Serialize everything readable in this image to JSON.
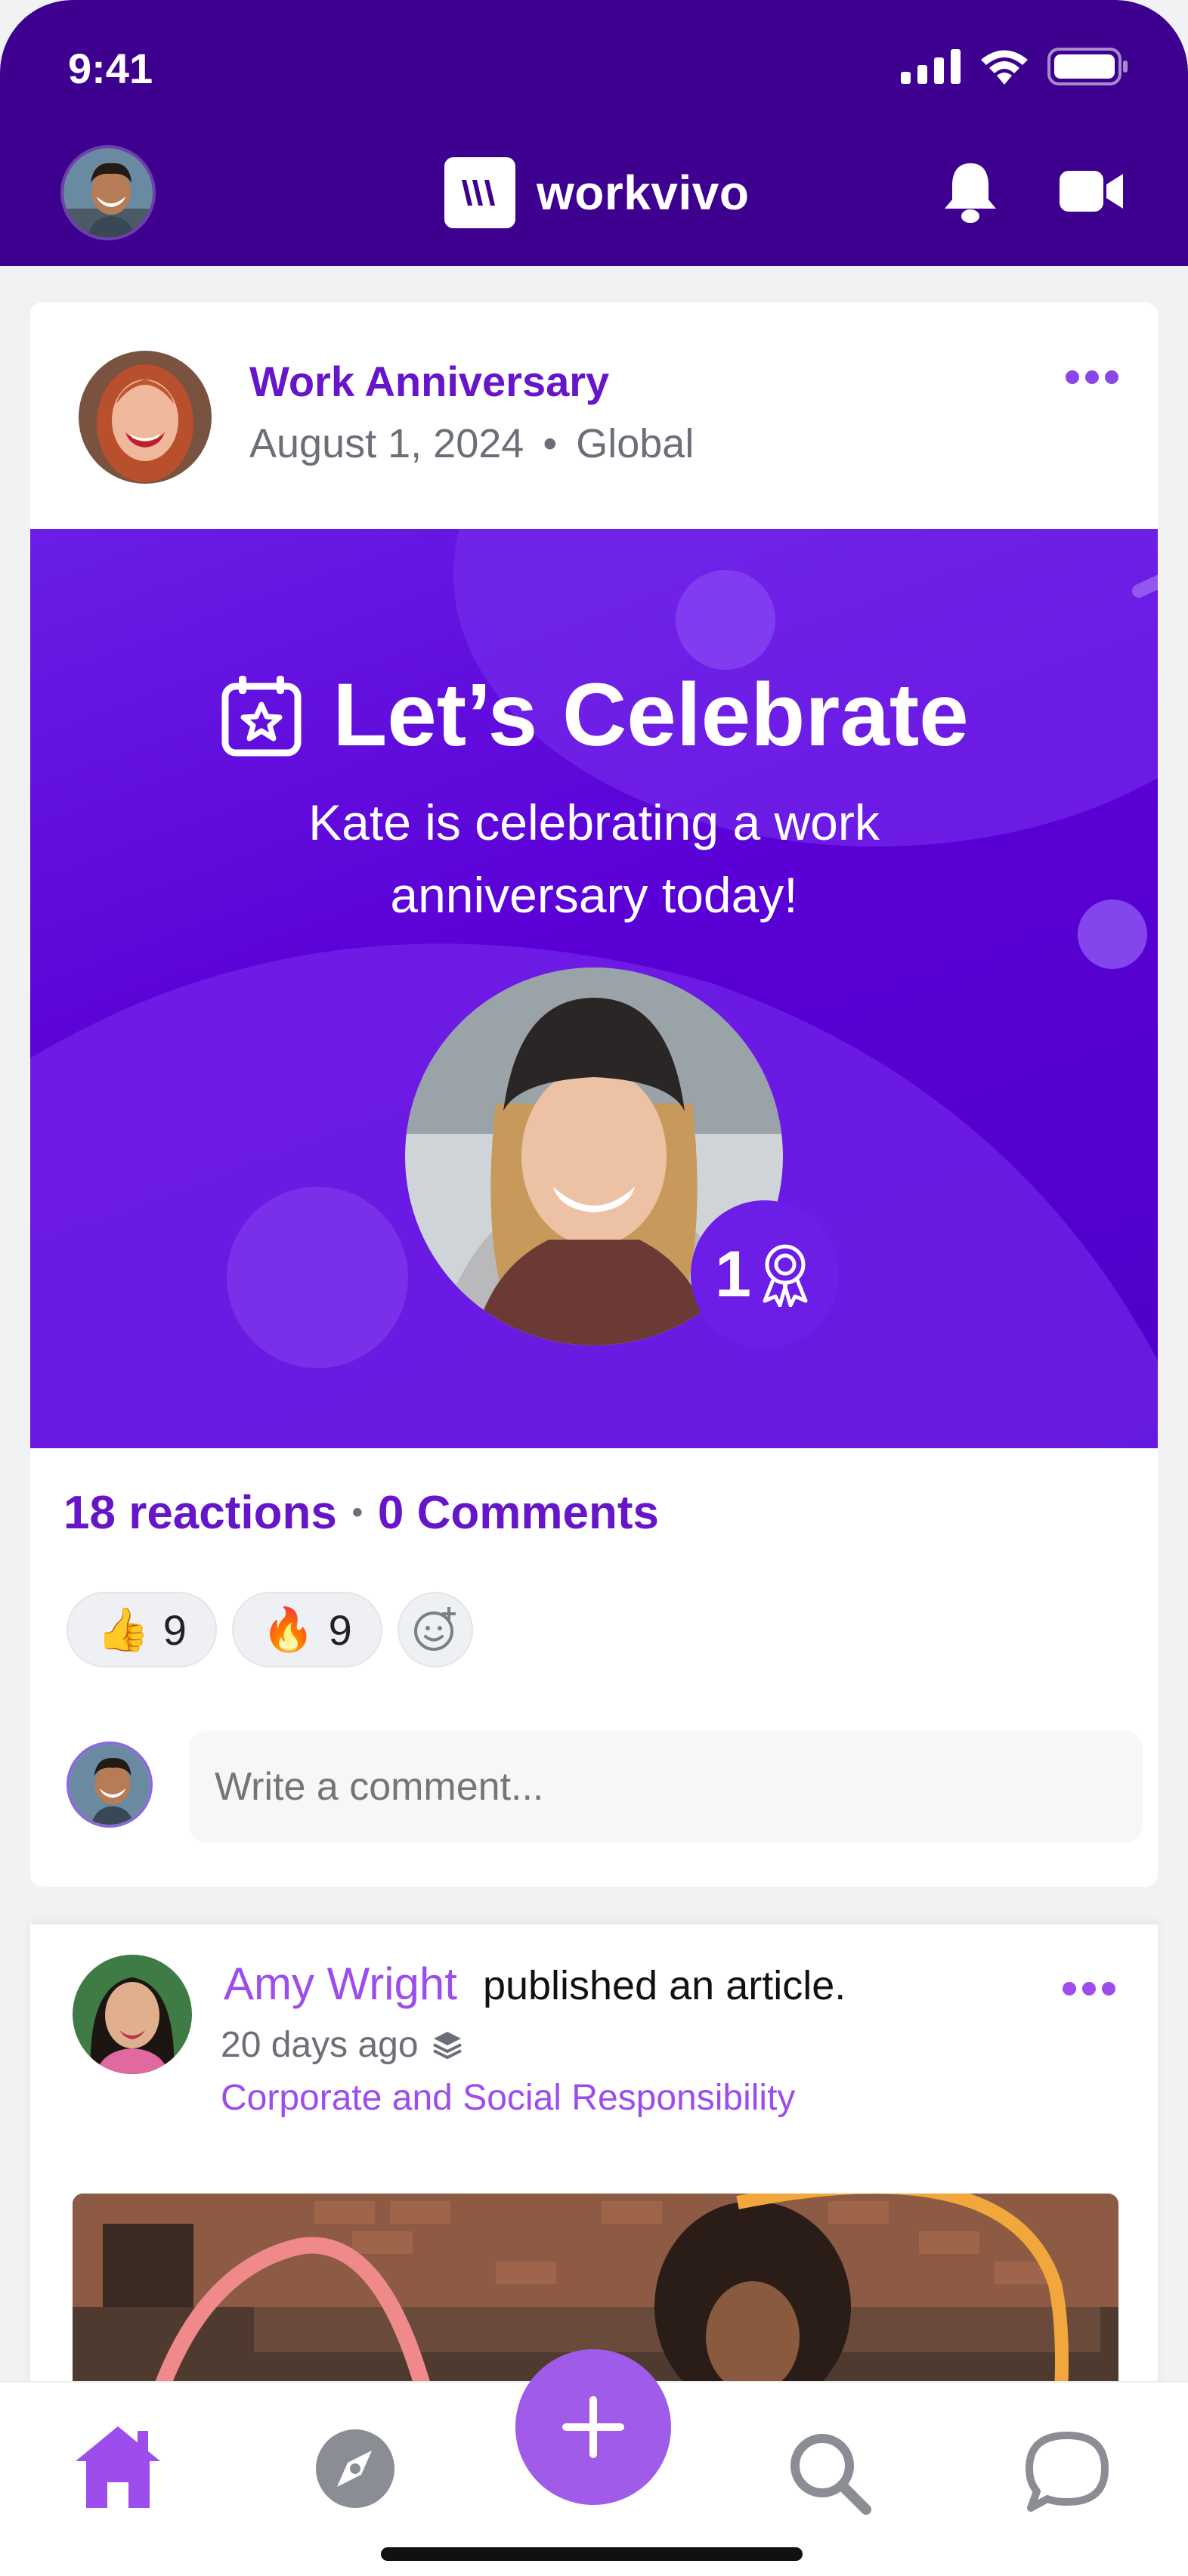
{
  "status_bar": {
    "time": "9:41"
  },
  "header": {
    "brand_name": "workvivo"
  },
  "post": {
    "title": "Work Anniversary",
    "date": "August 1, 2024",
    "separator": "•",
    "audience": "Global",
    "banner": {
      "title": "Let’s Celebrate",
      "subtitle_line1": "Kate is celebrating a work",
      "subtitle_line2": "anniversary today!",
      "badge_years": "1"
    },
    "reactions_label": "18 reactions",
    "comments_label": "0 Comments",
    "chips": [
      {
        "emoji": "👍",
        "count": "9"
      },
      {
        "emoji": "🔥",
        "count": "9"
      }
    ],
    "comment_placeholder": "Write a comment..."
  },
  "post2": {
    "author": "Amy Wright",
    "action": "published an article.",
    "time": "20 days ago",
    "category": "Corporate and Social Responsibility"
  },
  "colors": {
    "header_bg": "#3d008f",
    "accent": "#6615c9",
    "banner": "#5a00d6",
    "fab": "#a05be9",
    "muted": "#6b6f78"
  },
  "tabs": [
    {
      "name": "home",
      "icon": "home-icon"
    },
    {
      "name": "explore",
      "icon": "compass-icon"
    },
    {
      "name": "create",
      "icon": "plus-icon"
    },
    {
      "name": "search",
      "icon": "search-icon"
    },
    {
      "name": "chat",
      "icon": "chat-bubble-icon"
    }
  ]
}
